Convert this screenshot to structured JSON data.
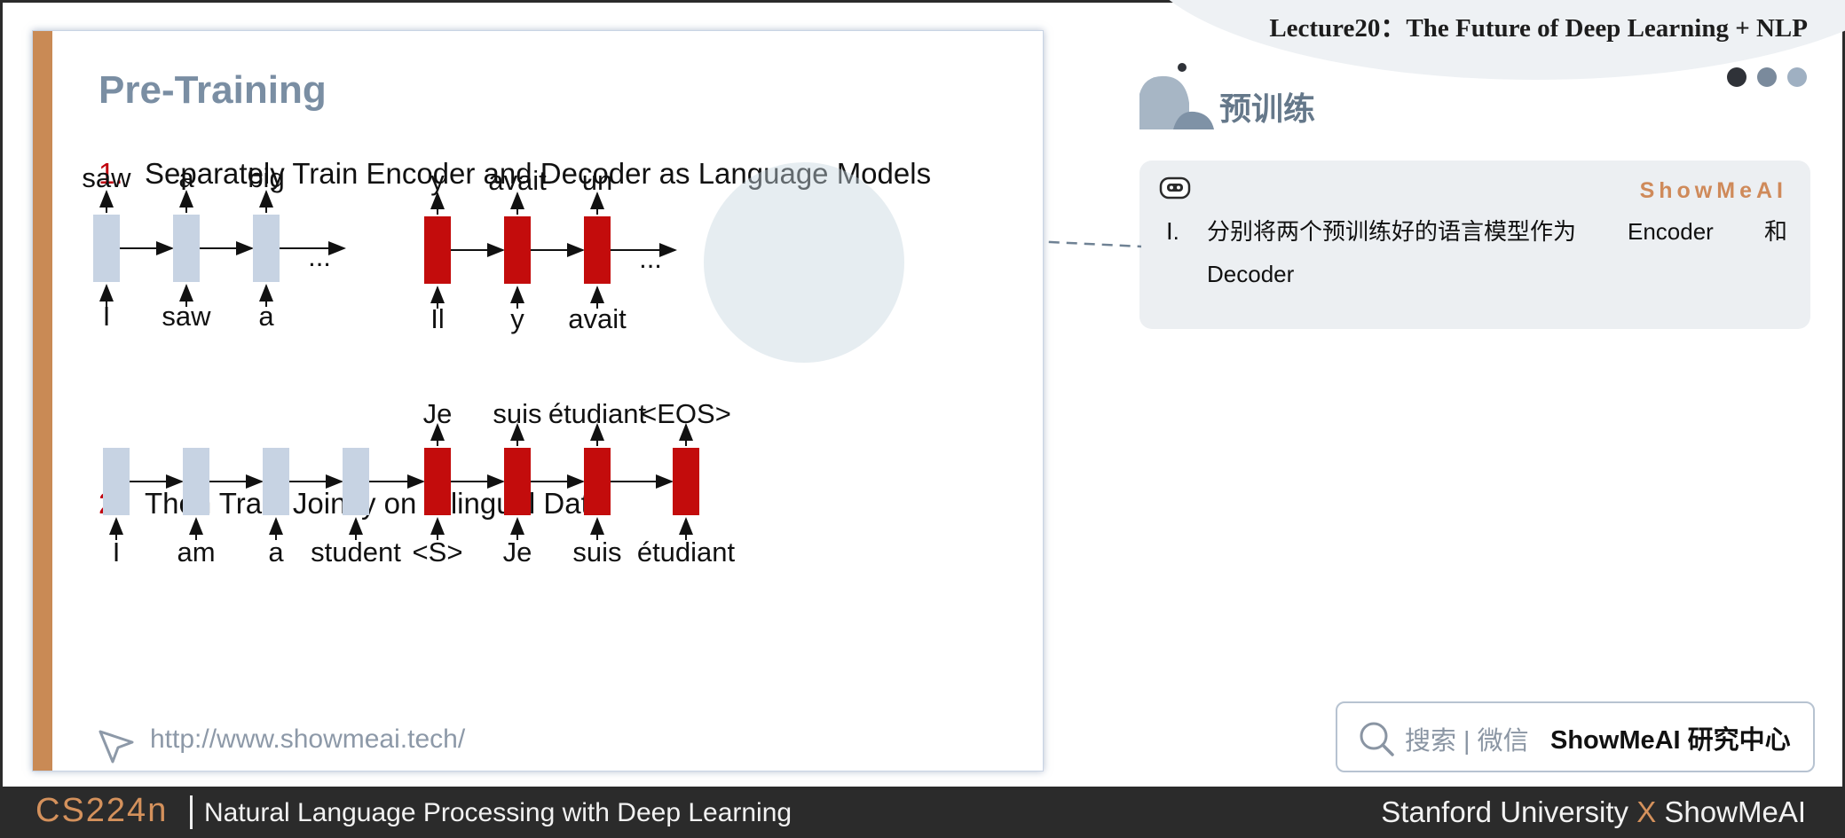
{
  "slide": {
    "title": "Pre-Training",
    "step1_num": "1.",
    "step1_text": "Separately Train Encoder and Decoder as Language Models",
    "step2_num": "2.",
    "step2_text": "Then Train Jointly on Bilingual Data",
    "enc_lm": {
      "outputs": [
        "saw",
        "a",
        "big"
      ],
      "inputs": [
        "I",
        "saw",
        "a"
      ],
      "ellipsis": "..."
    },
    "dec_lm": {
      "outputs": [
        "y",
        "avait",
        "un"
      ],
      "inputs": [
        "Il",
        "y",
        "avait"
      ],
      "ellipsis": "..."
    },
    "joint": {
      "outputs": [
        "Je",
        "suis",
        "étudiant",
        "<EOS>"
      ],
      "inputs": [
        "I",
        "am",
        "a",
        "student",
        "<S>",
        "Je",
        "suis",
        "étudiant"
      ]
    },
    "watermark": "http://www.showmeai.tech/",
    "colors": {
      "encoder": "#c7d3e3",
      "decoder": "#c30c0c",
      "accent_bar": "#c98a55"
    }
  },
  "header": {
    "lecture_title": "Lecture20：The Future of Deep Learning + NLP",
    "section_title": "预训练",
    "dots_colors": [
      "#2f3238",
      "#7a8a9c",
      "#9fb0c2"
    ]
  },
  "note": {
    "brand": "ShowMeAI",
    "roman": "Ⅰ.",
    "text": "分别将两个预训练好的语言模型作为",
    "encoder_word": "Encoder",
    "he": "和",
    "decoder_word": "Decoder"
  },
  "search": {
    "placeholder": "搜索 | 微信",
    "brand": "ShowMeAI 研究中心"
  },
  "footer": {
    "course": "CS224n",
    "subtitle": "Natural Language Processing with Deep Learning",
    "right_a": "Stanford University",
    "right_x": "X",
    "right_b": "ShowMeAI"
  },
  "icons": [
    "robot-icon",
    "search-icon",
    "cursor-icon"
  ]
}
